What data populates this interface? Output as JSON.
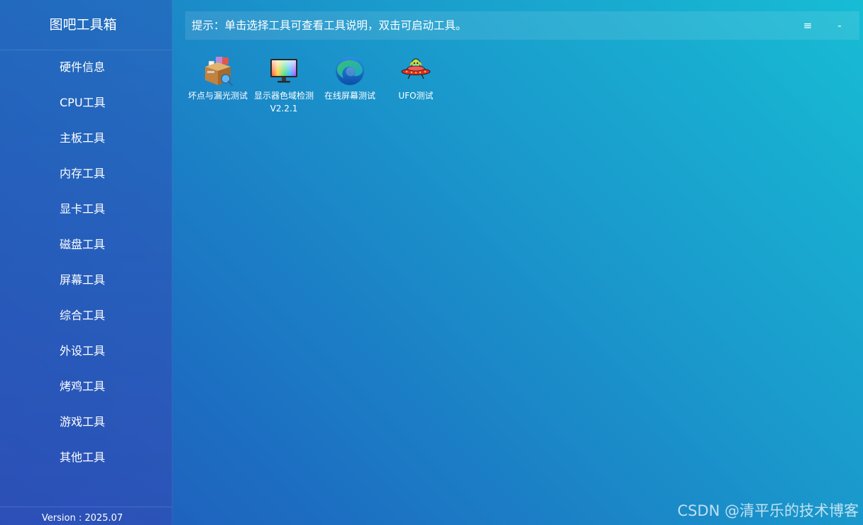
{
  "app": {
    "title": "图吧工具箱",
    "version": "Version : 2025.07"
  },
  "sidebar": {
    "items": [
      {
        "label": "硬件信息"
      },
      {
        "label": "CPU工具"
      },
      {
        "label": "主板工具"
      },
      {
        "label": "内存工具"
      },
      {
        "label": "显卡工具"
      },
      {
        "label": "磁盘工具"
      },
      {
        "label": "屏幕工具"
      },
      {
        "label": "综合工具"
      },
      {
        "label": "外设工具"
      },
      {
        "label": "烤鸡工具"
      },
      {
        "label": "游戏工具"
      },
      {
        "label": "其他工具"
      }
    ]
  },
  "hint": {
    "text": "提示：单击选择工具可查看工具说明，双击可启动工具。",
    "menu_glyph": "≡",
    "minimize_glyph": "-"
  },
  "tools": [
    {
      "label": "坏点与漏光测试",
      "icon": "package-box-icon"
    },
    {
      "label": "显示器色域检测V2.2.1",
      "icon": "color-monitor-icon"
    },
    {
      "label": "在线屏幕测试",
      "icon": "edge-browser-icon"
    },
    {
      "label": "UFO测试",
      "icon": "ufo-icon"
    }
  ],
  "watermark": "CSDN @清平乐的技术博客",
  "colors": {
    "background_start": "#17bcd4",
    "background_end": "#2157bb",
    "text": "#ffffff"
  }
}
